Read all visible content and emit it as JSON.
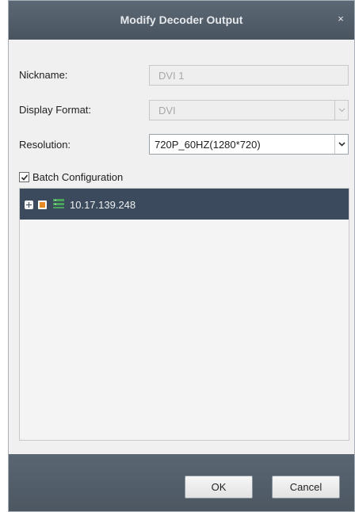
{
  "dialog": {
    "title": "Modify Decoder Output",
    "close_glyph": "×"
  },
  "form": {
    "nickname": {
      "label": "Nickname:",
      "value": "DVI 1"
    },
    "display_format": {
      "label": "Display Format:",
      "value": "DVI"
    },
    "resolution": {
      "label": "Resolution:",
      "value": "720P_60HZ(1280*720)"
    }
  },
  "batch": {
    "label": "Batch Configuration",
    "checked": true
  },
  "tree": {
    "nodes": [
      {
        "label": "10.17.139.248",
        "icon": "device-icon"
      }
    ]
  },
  "buttons": {
    "ok": "OK",
    "cancel": "Cancel"
  },
  "colors": {
    "titlebar": "#4f5a66",
    "tree_selected": "#3b4b5d",
    "checkbox_orange": "#e88a24",
    "device_green": "#4aa55a"
  }
}
